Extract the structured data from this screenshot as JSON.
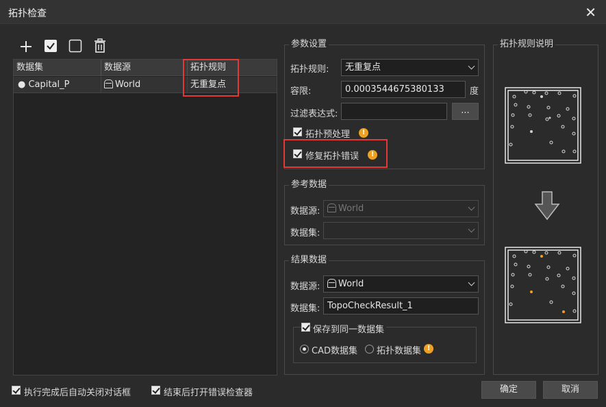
{
  "window": {
    "title": "拓扑检查",
    "close_label": "✕"
  },
  "toolbar": {
    "add": "＋",
    "select_all": "select-all",
    "deselect": "deselect",
    "delete": "delete"
  },
  "grid": {
    "headers": [
      "数据集",
      "数据源",
      "拓扑规则"
    ],
    "rows": [
      {
        "dataset": "Capital_P",
        "datasource": "World",
        "rule": "无重复点"
      }
    ]
  },
  "params": {
    "legend": "参数设置",
    "rule_label": "拓扑规则:",
    "rule_value": "无重复点",
    "tolerance_label": "容限:",
    "tolerance_value": "0.0003544675380133",
    "tolerance_unit": "度",
    "filter_label": "过滤表达式:",
    "filter_value": "",
    "filter_button": "...",
    "preprocess_label": "拓扑预处理",
    "repair_label": "修复拓扑错误"
  },
  "reference": {
    "legend": "参考数据",
    "datasource_label": "数据源:",
    "datasource_value": "World",
    "dataset_label": "数据集:",
    "dataset_value": ""
  },
  "result": {
    "legend": "结果数据",
    "datasource_label": "数据源:",
    "datasource_value": "World",
    "dataset_label": "数据集:",
    "dataset_value": "TopoCheckResult_1",
    "save_same_label": "保存到同一数据集",
    "cad_label": "CAD数据集",
    "topo_label": "拓扑数据集"
  },
  "rule_desc": {
    "legend": "拓扑规则说明"
  },
  "footer": {
    "auto_close_label": "执行完成后自动关闭对话框",
    "open_checker_label": "结束后打开错误检查器",
    "ok_label": "确定",
    "cancel_label": "取消"
  },
  "colors": {
    "background": "#2b2b2b",
    "highlight": "#e53935",
    "warning": "#f0a020"
  }
}
